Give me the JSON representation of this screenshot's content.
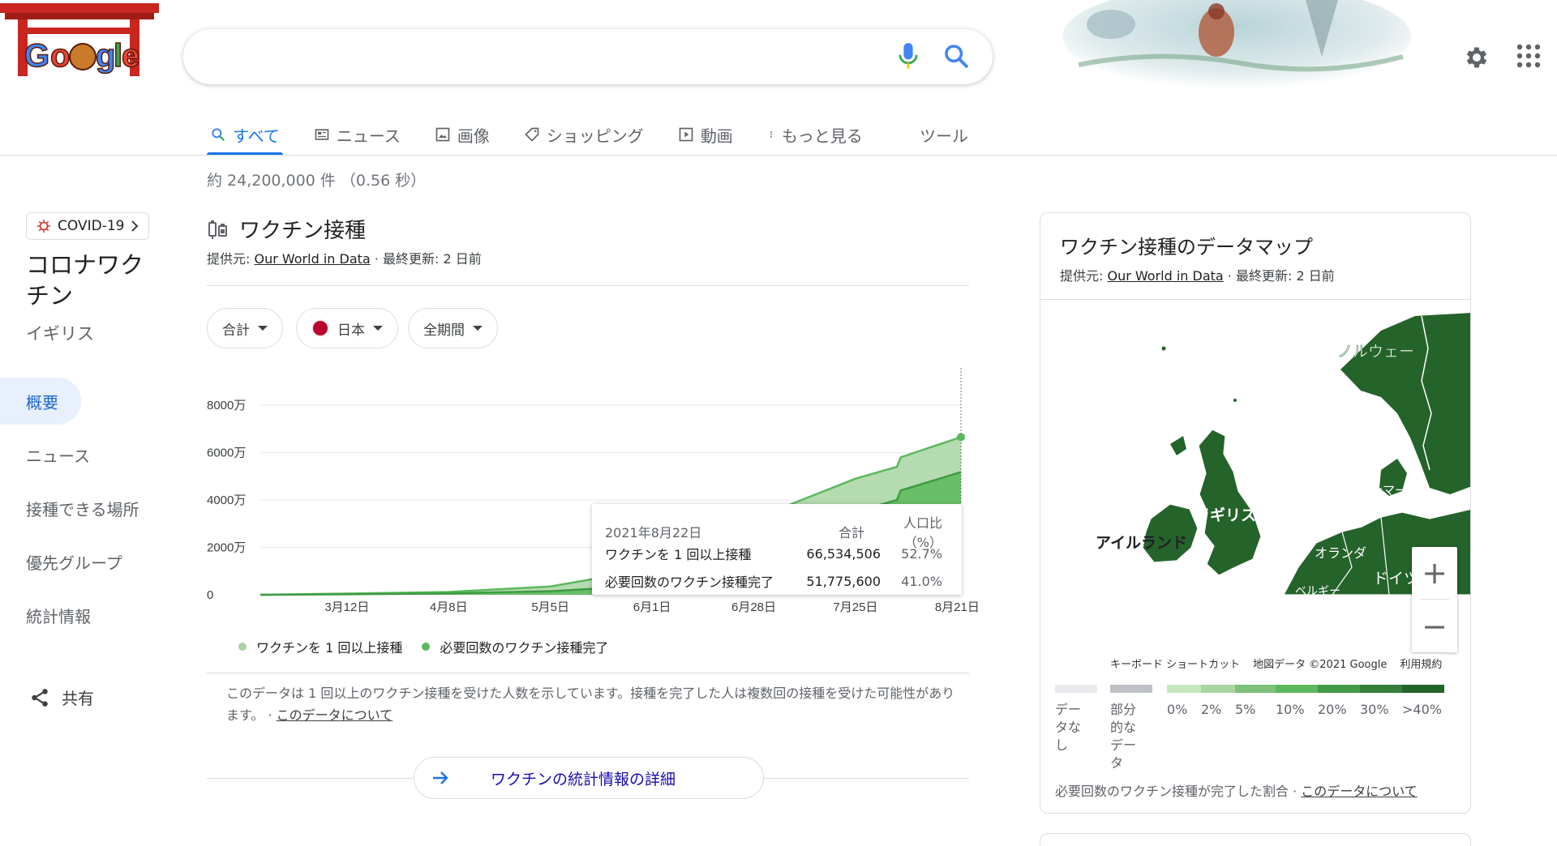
{
  "header": {
    "logo_text": "Google",
    "search_query": "",
    "colors": {
      "accent": "#1a73e8",
      "link": "#1a0dab",
      "muted": "#5f6368",
      "green_dark": "#2e6b34"
    }
  },
  "tabs": [
    {
      "label": "すべて",
      "icon": "search-icon",
      "active": true
    },
    {
      "label": "ニュース",
      "icon": "news-icon"
    },
    {
      "label": "画像",
      "icon": "image-icon"
    },
    {
      "label": "ショッピング",
      "icon": "tag-icon"
    },
    {
      "label": "動画",
      "icon": "video-icon"
    },
    {
      "label": "もっと見る",
      "icon": "more-dots-icon"
    }
  ],
  "tools_label": "ツール",
  "result_stats": "約 24,200,000 件 （0.56 秒）",
  "left_panel": {
    "chip_label": "COVID-19",
    "title": "コロナワクチン",
    "region": "イギリス",
    "nav": [
      "概要",
      "ニュース",
      "接種できる場所",
      "優先グループ",
      "統計情報"
    ],
    "share_label": "共有"
  },
  "vaccination": {
    "title": "ワクチン接種",
    "source_prefix": "提供元: ",
    "source_name": "Our World in Data",
    "updated": " · 最終更新: 2 日前",
    "filters": {
      "total": "合計",
      "country": "日本",
      "period": "全期間"
    },
    "tooltip": {
      "date": "2021年8月22日",
      "col_total": "合計",
      "col_pct": "人口比（%）",
      "rows": [
        {
          "label": "ワクチンを 1 回以上接種",
          "total": "66,534,506",
          "pct": "52.7%"
        },
        {
          "label": "必要回数のワクチン接種完了",
          "total": "51,775,600",
          "pct": "41.0%"
        }
      ]
    },
    "note_text": "このデータは 1 回以上のワクチン接種を受けた人数を示しています。接種を完了した人は複数回の接種を受けた可能性があります。 · ",
    "note_link": "このデータについて",
    "more_button": "ワクチンの統計情報の詳細"
  },
  "chart_data": {
    "type": "area",
    "x": [
      "2021-02-17",
      "2021-03-12",
      "2021-04-08",
      "2021-05-05",
      "2021-06-01",
      "2021-06-28",
      "2021-07-25",
      "2021-08-05",
      "2021-08-06",
      "2021-08-22"
    ],
    "x_tick_labels": [
      "3月12日",
      "4月8日",
      "5月5日",
      "6月1日",
      "6月28日",
      "7月25日",
      "8月21日"
    ],
    "y_tick_labels": [
      "0",
      "2000万",
      "4000万",
      "6000万",
      "8000万"
    ],
    "ylim": [
      0,
      80000000
    ],
    "grid": true,
    "series": [
      {
        "name": "ワクチンを 1 回以上接種",
        "color": "#a8d5a2",
        "values": [
          0,
          500000,
          1200000,
          3500000,
          11000000,
          32000000,
          49000000,
          54000000,
          58000000,
          66534506
        ]
      },
      {
        "name": "必要回数のワクチン接種完了",
        "color": "#5cb85c",
        "values": [
          0,
          200000,
          600000,
          1500000,
          4000000,
          16000000,
          35000000,
          40000000,
          44000000,
          51775600
        ]
      }
    ]
  },
  "map": {
    "title": "ワクチン接種のデータマップ",
    "source_prefix": "提供元: ",
    "source_name": "Our World in Data",
    "updated": " · 最終更新: 2 日前",
    "labels": [
      "ノルウェー",
      "デンマーク",
      "イギリス",
      "アイルランド",
      "オランダ",
      "ドイツ",
      "ベルギー"
    ],
    "attribution": [
      "キーボード ショートカット",
      "地図データ ©2021 Google",
      "利用規約"
    ],
    "legend": [
      {
        "label": "データなし",
        "color": "#e8eaed"
      },
      {
        "label": "部分的なデータ",
        "color": "#bdc1c6"
      },
      {
        "label": "0%",
        "color": "#c8e6c0"
      },
      {
        "label": "2%",
        "color": "#a8d5a2"
      },
      {
        "label": "5%",
        "color": "#7dc17a"
      },
      {
        "label": "10%",
        "color": "#5cb85c"
      },
      {
        "label": "20%",
        "color": "#439a46"
      },
      {
        "label": "30%",
        "color": "#347f39"
      },
      {
        "label": ">40%",
        "color": "#24632a"
      }
    ],
    "footer_text": "必要回数のワクチン接種が完了した割合 · ",
    "footer_link": "このデータについて"
  }
}
